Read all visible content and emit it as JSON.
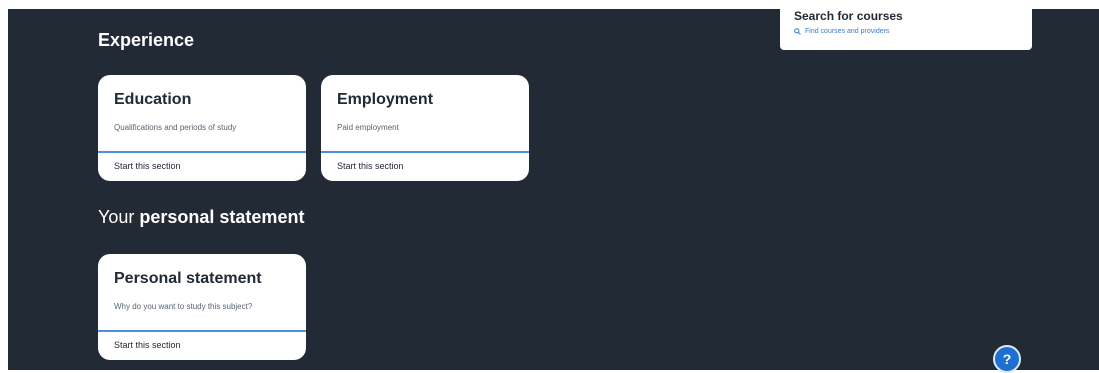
{
  "search": {
    "title": "Search for courses",
    "link_label": "Find courses and providers",
    "icon": "search-icon"
  },
  "sections": {
    "experience_heading": "Experience",
    "personal_heading_prefix": "Your",
    "personal_heading_bold": "personal statement"
  },
  "cards": {
    "education": {
      "title": "Education",
      "description": "Qualifications and periods of study",
      "action": "Start this section"
    },
    "employment": {
      "title": "Employment",
      "description": "Paid employment",
      "action": "Start this section"
    },
    "personal_statement": {
      "title": "Personal statement",
      "description": "Why do you want to study this subject?",
      "action": "Start this section"
    }
  },
  "help": {
    "label": "?",
    "icon": "help-icon"
  },
  "colors": {
    "background": "#222a36",
    "card": "#ffffff",
    "accent": "#4f8fd6",
    "help_button": "#1f6fd1"
  }
}
